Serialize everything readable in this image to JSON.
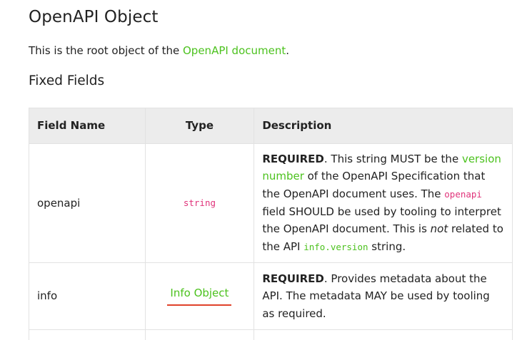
{
  "page": {
    "title": "OpenAPI Object",
    "intro_prefix": "This is the root object of the ",
    "intro_link": "OpenAPI document",
    "intro_suffix": ".",
    "section_title": "Fixed Fields"
  },
  "table": {
    "headers": {
      "field_name": "Field Name",
      "type": "Type",
      "description": "Description"
    },
    "rows": [
      {
        "field": "openapi",
        "type": "string",
        "desc_required": "REQUIRED",
        "desc_part1": ". This string MUST be the ",
        "desc_link": "version number",
        "desc_part2": " of the OpenAPI Specification that the OpenAPI document uses. The ",
        "desc_code1": "openapi",
        "desc_part3": " field SHOULD be used by tooling to interpret the OpenAPI document. This is ",
        "desc_em": "not",
        "desc_part4": " related to the API ",
        "desc_code2": "info.version",
        "desc_part5": " string."
      },
      {
        "field": "info",
        "type": "Info Object",
        "desc_required": "REQUIRED",
        "desc_text": ". Provides metadata about the API. The metadata MAY be used by tooling as required."
      }
    ]
  },
  "colors": {
    "link": "#4cc21e",
    "code_pink": "#e0337a",
    "header_bg": "#ececec",
    "underline": "#e0422a"
  }
}
